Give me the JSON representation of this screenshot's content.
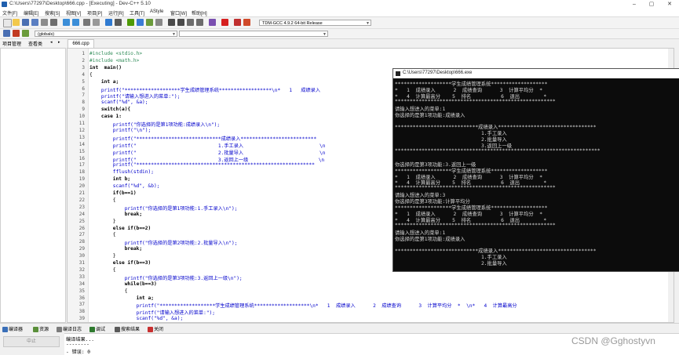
{
  "window": {
    "title": "C:\\Users\\77297\\Desktop\\666.cpp - [Executing] - Dev-C++ 5.10",
    "controls": [
      "–",
      "▢",
      "✕"
    ]
  },
  "menu": [
    "文件[F]",
    "编辑[E]",
    "搜索[S]",
    "视图[V]",
    "项目[P]",
    "运行[R]",
    "工具[T]",
    "AStyle",
    "窗口[W]",
    "帮助[H]"
  ],
  "toolbar": {
    "compiler": "TDM-GCC 4.9.2 64-bit Release",
    "scope": "(globals)"
  },
  "left_panel": {
    "tabs": [
      "项目管理",
      "查看类"
    ]
  },
  "editor": {
    "file_tab": "666.cpp",
    "line_numbers": [
      "1",
      "2",
      "3",
      "4",
      "5",
      "6",
      "7",
      "8",
      "9",
      "10",
      "11",
      "12",
      "13",
      "14",
      "15",
      "16",
      "17",
      "18",
      "19",
      "20",
      "21",
      "22",
      "23",
      "24",
      "25",
      "26",
      "27",
      "28",
      "29",
      "30",
      "31",
      "32",
      "33",
      "34",
      "35",
      "36",
      "37",
      "38",
      "39"
    ],
    "lines": [
      "#include <stdio.h>",
      "#include <math.h>",
      "int  main()",
      "{",
      "    int a;",
      "    printf(\"*******************学生成绩管理系统******************\\n*   1   成绩录入",
      "    printf(\"请输入想进入的菜单:\");",
      "    scanf(\"%d\", &a);",
      "    switch(a){",
      "    case 1:",
      "        printf(\"你选择的是第1项功能:成绩录入\\n\");",
      "        printf(\"\\n\");",
      "        printf(\"*****************************成绩录入**************************",
      "        printf(\"                            1.手工录入                          \\n",
      "        printf(\"                            2.批量导入                          \\n",
      "        printf(\"                            3.返回上一级                        \\n",
      "        printf(\"*************************************************************",
      "        fflush(stdin);",
      "        int b;",
      "        scanf(\"%d\", &b);",
      "        if(b==1)",
      "        {",
      "            printf(\"你选择的是第1项功能:1.手工录入\\n\");",
      "            break;",
      "        }",
      "        else if(b==2)",
      "        {",
      "            printf(\"你选择的是第2项功能:2.批量导入\\n\");",
      "            break;",
      "        }",
      "        else if(b==3)",
      "        {",
      "            printf(\"你选择的是第3项功能:3.返回上一级\\n\");",
      "            while(b==3)",
      "            {",
      "                int a;",
      "                printf(\"*******************学生成绩管理系统*******************\\n*   1  成绩录入      2  成绩查询      3  计算平均分  *  \\n*   4  计算最高分",
      "                printf(\"请输入想进入的菜单:\");",
      "                scanf(\"%d\", &a);"
    ]
  },
  "console": {
    "title": "C:\\Users\\77297\\Desktop\\666.exe",
    "lines": [
      "*******************学生成绩管理系统*******************",
      "*   1  成绩录入      2  成绩查询      3  计算平均分  *",
      "*   4  计算最高分    5  排名          6  退出        *",
      "******************************************************",
      "请输入想进入的菜单:1",
      "你选择的是第1项功能:成绩录入",
      "",
      "****************************成绩录入*********************************",
      "                             1.手工录入",
      "                             2.批量导入",
      "                             3.返回上一级",
      "*********************************************************************",
      "",
      "你选择的是第3项功能:3.返回上一级",
      "*******************学生成绩管理系统*******************",
      "*   1  成绩录入      2  成绩查询      3  计算平均分  *",
      "*   4  计算最高分    5  排名          6  退出        *",
      "******************************************************",
      "请输入想进入的菜单:3",
      "你选择的是第3项功能:计算平均分",
      "*******************学生成绩管理系统*******************",
      "*   1  成绩录入      2  成绩查询      3  计算平均分  *",
      "*   4  计算最高分    5  排名          6  退出        *",
      "******************************************************",
      "请输入想进入的菜单:1",
      "你选择的是第1项功能:成绩录入",
      "",
      "****************************成绩录入*********************************",
      "                             1.手工录入",
      "                             2.批量导入"
    ]
  },
  "bottom": {
    "tabs": [
      "编译器",
      "资源",
      "编译日志",
      "调试",
      "搜索结果",
      "关闭"
    ],
    "abort_label": "中止",
    "output": [
      "编译结果...",
      "--------",
      "- 错误: 0"
    ]
  },
  "watermark": "CSDN @Gghostyvn"
}
